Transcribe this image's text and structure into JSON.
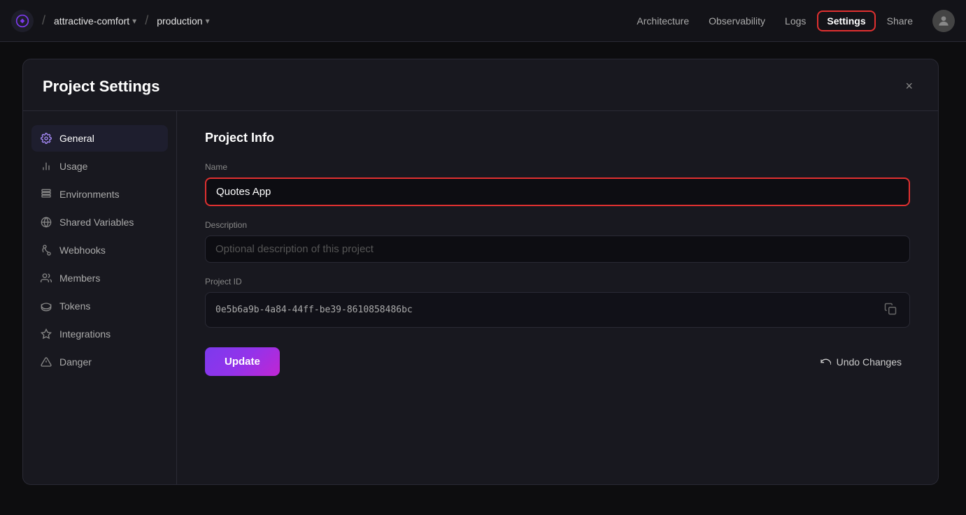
{
  "topbar": {
    "project_name": "attractive-comfort",
    "env_name": "production",
    "nav_items": [
      {
        "id": "architecture",
        "label": "Architecture"
      },
      {
        "id": "observability",
        "label": "Observability"
      },
      {
        "id": "logs",
        "label": "Logs"
      },
      {
        "id": "settings",
        "label": "Settings"
      },
      {
        "id": "share",
        "label": "Share"
      }
    ]
  },
  "settings_modal": {
    "title": "Project Settings",
    "close_label": "×",
    "sidebar_items": [
      {
        "id": "general",
        "label": "General",
        "icon": "gear"
      },
      {
        "id": "usage",
        "label": "Usage",
        "icon": "bar-chart"
      },
      {
        "id": "environments",
        "label": "Environments",
        "icon": "layers"
      },
      {
        "id": "shared-variables",
        "label": "Shared Variables",
        "icon": "globe"
      },
      {
        "id": "webhooks",
        "label": "Webhooks",
        "icon": "webhook"
      },
      {
        "id": "members",
        "label": "Members",
        "icon": "users"
      },
      {
        "id": "tokens",
        "label": "Tokens",
        "icon": "token"
      },
      {
        "id": "integrations",
        "label": "Integrations",
        "icon": "integrations"
      },
      {
        "id": "danger",
        "label": "Danger",
        "icon": "danger"
      }
    ],
    "section_title": "Project Info",
    "name_label": "Name",
    "name_value": "Quotes App",
    "description_label": "Description",
    "description_placeholder": "Optional description of this project",
    "project_id_label": "Project ID",
    "project_id_value": "0e5b6a9b-4a84-44ff-be39-8610858486bc",
    "update_label": "Update",
    "undo_label": "Undo Changes"
  }
}
